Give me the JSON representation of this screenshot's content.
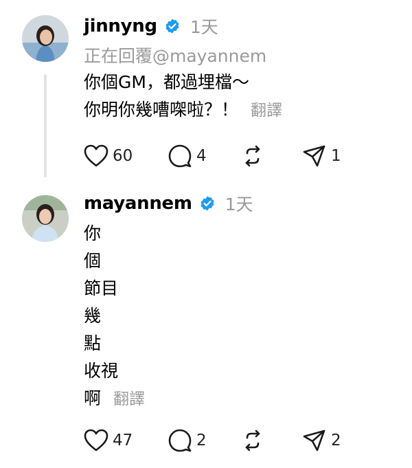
{
  "posts": [
    {
      "username": "jinnyng",
      "time": "1天",
      "replying_to": "正在回覆@mayannem",
      "lines": [
        "你個GM，都過埋檔～",
        "你明你幾嘈㗎啦？！"
      ],
      "translate": "翻譯",
      "likes": "60",
      "comments": "4",
      "reposts": "",
      "shares": "1"
    },
    {
      "username": "mayannem",
      "time": "1天",
      "lines": [
        "你",
        "個",
        "節目",
        "幾",
        "點",
        "收視",
        "啊"
      ],
      "translate": "翻譯",
      "likes": "47",
      "comments": "2",
      "reposts": "",
      "shares": "2"
    }
  ],
  "colors": {
    "verified": "#1d9bf0",
    "muted": "#9a9a9a",
    "thread_line": "#e3e3e3"
  },
  "icons": [
    "heart-icon",
    "comment-icon",
    "repost-icon",
    "share-icon",
    "verified-badge-icon"
  ]
}
